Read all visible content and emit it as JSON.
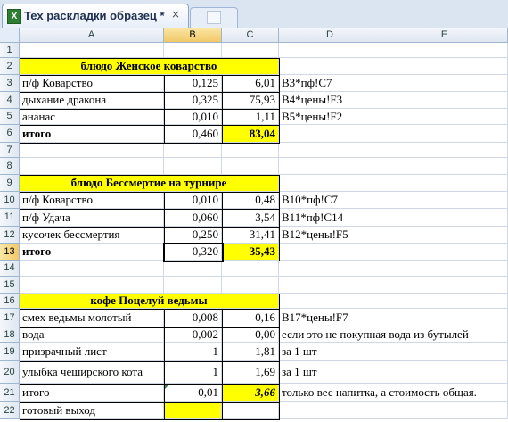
{
  "window": {
    "tab_title": "Тех раскладки образец *",
    "app_icon": "X",
    "close_glyph": "×",
    "icons": [
      "excel-icon",
      "close-icon",
      "new-tab-icon"
    ]
  },
  "columns": [
    "A",
    "B",
    "C",
    "D",
    "E"
  ],
  "rows": [
    "1",
    "2",
    "3",
    "4",
    "5",
    "6",
    "7",
    "8",
    "9",
    "10",
    "11",
    "12",
    "13",
    "14",
    "15",
    "16",
    "17",
    "18",
    "19",
    "20",
    "21",
    "22"
  ],
  "selection": {
    "column": "B",
    "row": "13"
  },
  "colors": {
    "highlight": "#ffff00",
    "grid": "#d0d7e5",
    "header": "#dfe7f1"
  },
  "sections": [
    {
      "title": "блюдо Женское коварство",
      "items": [
        {
          "name": "п/ф Коварство",
          "qty": "0,125",
          "cost": "6,01",
          "formula": "B3*пф!C7"
        },
        {
          "name": "дыхание дракона",
          "qty": "0,325",
          "cost": "75,93",
          "formula": "B4*цены!F3"
        },
        {
          "name": "ананас",
          "qty": "0,010",
          "cost": "1,11",
          "formula": "B5*цены!F2"
        }
      ],
      "total": {
        "label": "итого",
        "qty": "0,460",
        "cost": "83,04"
      }
    },
    {
      "title": "блюдо Бессмертие на турнире",
      "items": [
        {
          "name": "п/ф Коварство",
          "qty": "0,010",
          "cost": "0,48",
          "formula": "B10*пф!C7"
        },
        {
          "name": "п/ф Удача",
          "qty": "0,060",
          "cost": "3,54",
          "formula": "B11*пф!C14"
        },
        {
          "name": "кусочек бессмертия",
          "qty": "0,250",
          "cost": "31,41",
          "formula": "B12*цены!F5"
        }
      ],
      "total": {
        "label": "итого",
        "qty": "0,320",
        "cost": "35,43"
      }
    },
    {
      "title": "кофе Поцелуй ведьмы",
      "items": [
        {
          "name": "смех ведьмы молотый",
          "qty": "0,008",
          "cost": "0,16",
          "formula": "B17*цены!F7"
        },
        {
          "name": "вода",
          "qty": "0,002",
          "cost": "0,00",
          "formula": "если это не покупная вода из бутылей"
        },
        {
          "name": "призрачный лист",
          "qty": "1",
          "cost": "1,81",
          "formula": "за 1 шт"
        },
        {
          "name": "улыбка чеширского кота",
          "qty": "1",
          "cost": "1,69",
          "formula": "за 1 шт"
        }
      ],
      "total": {
        "label": "итого",
        "qty": "0,01",
        "cost": "3,66",
        "note": "только вес напитка, а стоимость общая."
      },
      "output": {
        "label": "готовый выход",
        "qty": "",
        "cost": ""
      }
    }
  ]
}
